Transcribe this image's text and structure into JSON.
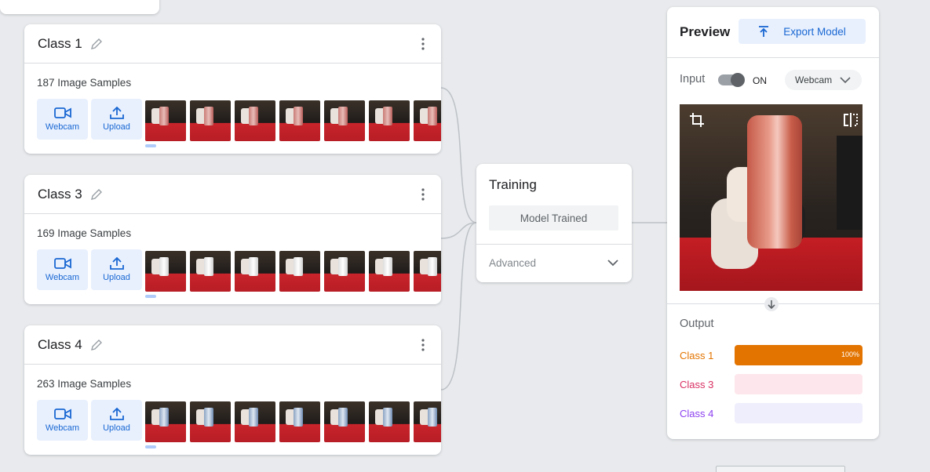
{
  "classes": [
    {
      "title": "Class 1",
      "samples": "187 Image Samples",
      "thumb_style": "red",
      "webcam_label": "Webcam",
      "upload_label": "Upload"
    },
    {
      "title": "Class 3",
      "samples": "169 Image Samples",
      "thumb_style": "white",
      "webcam_label": "Webcam",
      "upload_label": "Upload"
    },
    {
      "title": "Class 4",
      "samples": "263 Image Samples",
      "thumb_style": "blue",
      "webcam_label": "Webcam",
      "upload_label": "Upload"
    }
  ],
  "training": {
    "title": "Training",
    "button_label": "Model Trained",
    "advanced_label": "Advanced"
  },
  "preview": {
    "title": "Preview",
    "export_label": "Export Model",
    "input_label": "Input",
    "toggle_label": "ON",
    "toggle_on": true,
    "source_label": "Webcam",
    "output_label": "Output",
    "outputs": [
      {
        "name": "Class 1",
        "percent": 100,
        "percent_label": "100%",
        "color": "#e37400",
        "track": "#e37400"
      },
      {
        "name": "Class 3",
        "percent": 0,
        "percent_label": "",
        "color": "#d93063",
        "track": "#fde7ec"
      },
      {
        "name": "Class 4",
        "percent": 0,
        "percent_label": "",
        "color": "#8c41f0",
        "track": "#efeefc"
      }
    ]
  },
  "colors": {
    "accent": "#1967d2",
    "accent_bg": "#e8f0fe",
    "canvas": "#e8eaed"
  }
}
